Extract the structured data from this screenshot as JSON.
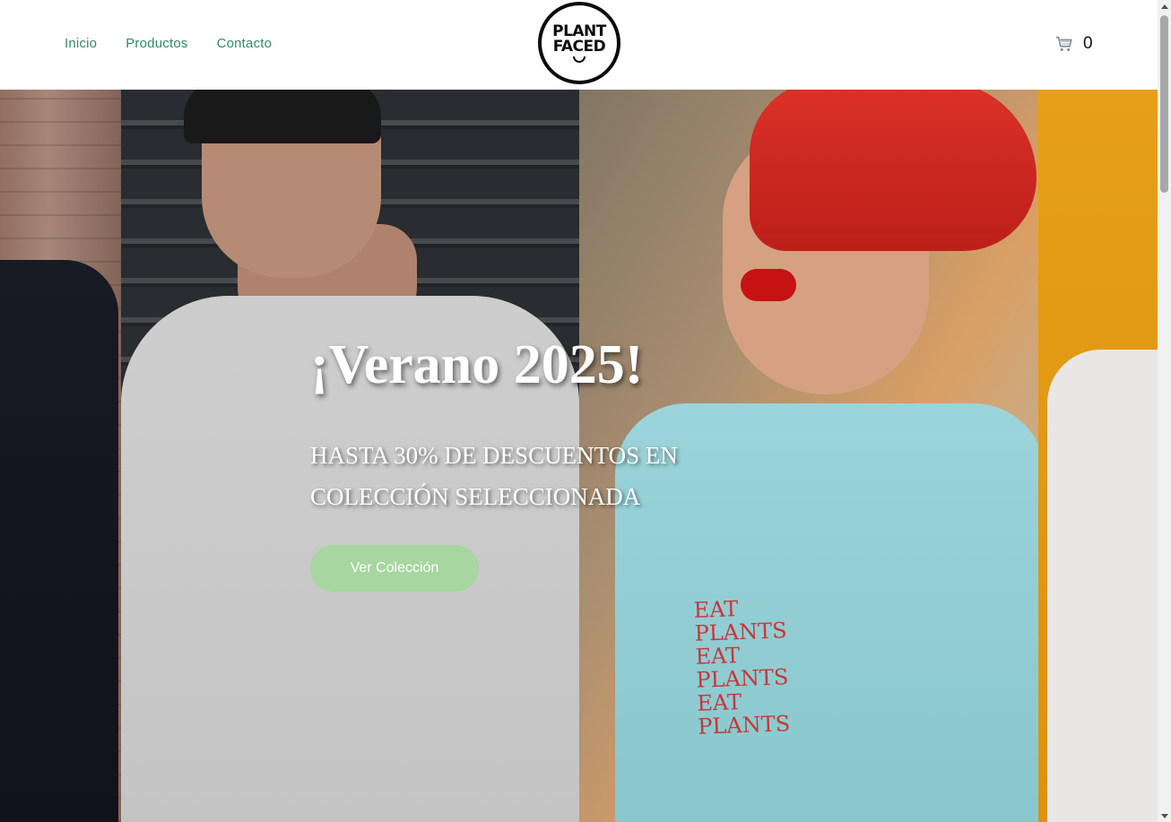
{
  "header": {
    "nav": [
      {
        "label": "Inicio"
      },
      {
        "label": "Productos"
      },
      {
        "label": "Contacto"
      }
    ],
    "logo": {
      "line1": "PLANT",
      "line2": "FACED"
    },
    "cart": {
      "icon": "cart-icon",
      "count": "0"
    }
  },
  "hero": {
    "title": "¡Verano 2025!",
    "subtitle": "HASTA 30% DE DESCUENTOS EN COLECCIÓN SELECCIONADA",
    "button_label": "Ver Colección",
    "shirt_print": [
      "EAT PLANTS",
      "EAT PLANTS",
      "EAT PLANTS"
    ]
  },
  "colors": {
    "nav_link": "#2e8b6a",
    "button_bg": "#a7d6a0",
    "accent_red": "#e8352a"
  }
}
